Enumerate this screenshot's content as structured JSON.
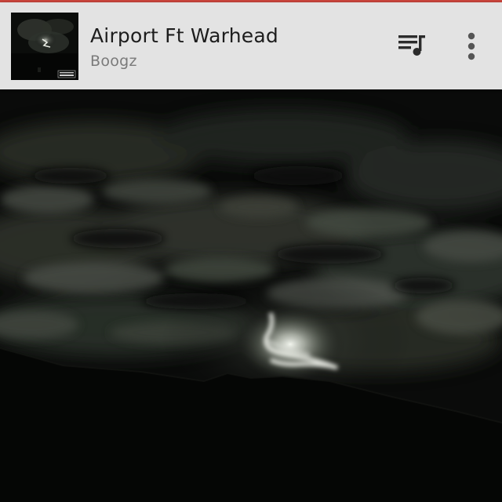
{
  "now_playing": {
    "title": "Airport Ft Warhead",
    "artist": "Boogz"
  },
  "actions": {
    "queue_icon": "queue-music-icon",
    "more_icon": "more-vert-icon"
  },
  "colors": {
    "accent": "#c9453c",
    "header_bg": "#e3e3e3",
    "title_text": "#1d1d1d",
    "artist_text": "#7a7a7a",
    "icon": "#555555"
  }
}
